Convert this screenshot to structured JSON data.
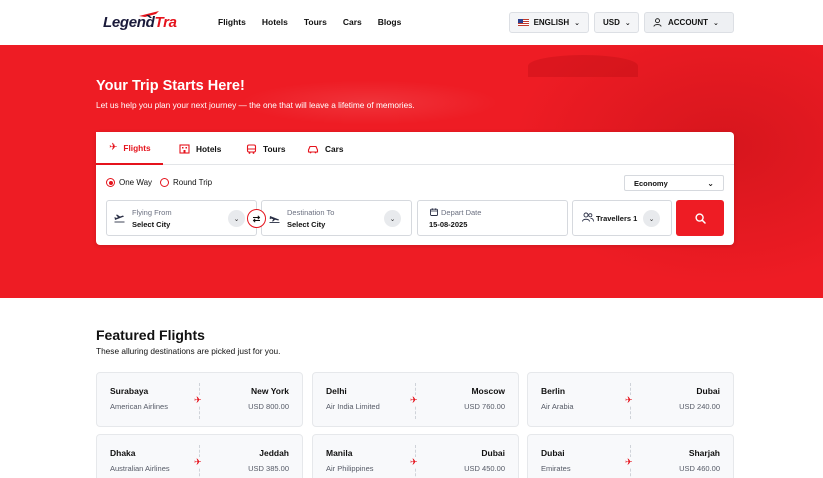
{
  "brand": {
    "part1": "Legend",
    "part2": "Tra"
  },
  "nav": {
    "menu": [
      "Flights",
      "Hotels",
      "Tours",
      "Cars",
      "Blogs"
    ],
    "language": "ENGLISH",
    "currency": "USD",
    "account": "ACCOUNT"
  },
  "hero": {
    "title": "Your Trip Starts Here!",
    "subtitle": "Let us help you plan your next journey — the one that will leave a lifetime of memories."
  },
  "search": {
    "tabs": [
      {
        "label": "Flights",
        "icon": "plane-icon",
        "active": true
      },
      {
        "label": "Hotels",
        "icon": "hotel-icon"
      },
      {
        "label": "Tours",
        "icon": "bus-icon"
      },
      {
        "label": "Cars",
        "icon": "car-icon"
      }
    ],
    "trip_types": [
      {
        "label": "One Way",
        "selected": true
      },
      {
        "label": "Round Trip",
        "selected": false
      }
    ],
    "cabin_class": "Economy",
    "from": {
      "label": "Flying From",
      "value": "Select City"
    },
    "to": {
      "label": "Destination To",
      "value": "Select City"
    },
    "date": {
      "label": "Depart Date",
      "value": "15-08-2025"
    },
    "travellers": "Travellers 1"
  },
  "featured": {
    "title": "Featured Flights",
    "subtitle": "These alluring destinations are picked just for you.",
    "flights": [
      {
        "from": "Surabaya",
        "to": "New York",
        "airline": "American Airlines",
        "price": "USD 800.00"
      },
      {
        "from": "Delhi",
        "to": "Moscow",
        "airline": "Air India Limited",
        "price": "USD 760.00"
      },
      {
        "from": "Berlin",
        "to": "Dubai",
        "airline": "Air Arabia",
        "price": "USD 240.00"
      },
      {
        "from": "Dhaka",
        "to": "Jeddah",
        "airline": "Australian Airlines",
        "price": "USD 385.00"
      },
      {
        "from": "Manila",
        "to": "Dubai",
        "airline": "Air Philippines",
        "price": "USD 450.00"
      },
      {
        "from": "Dubai",
        "to": "Sharjah",
        "airline": "Emirates",
        "price": "USD 460.00"
      }
    ]
  },
  "colors": {
    "brand_red": "#ee1c24",
    "dark_navy": "#1a1a3a"
  }
}
